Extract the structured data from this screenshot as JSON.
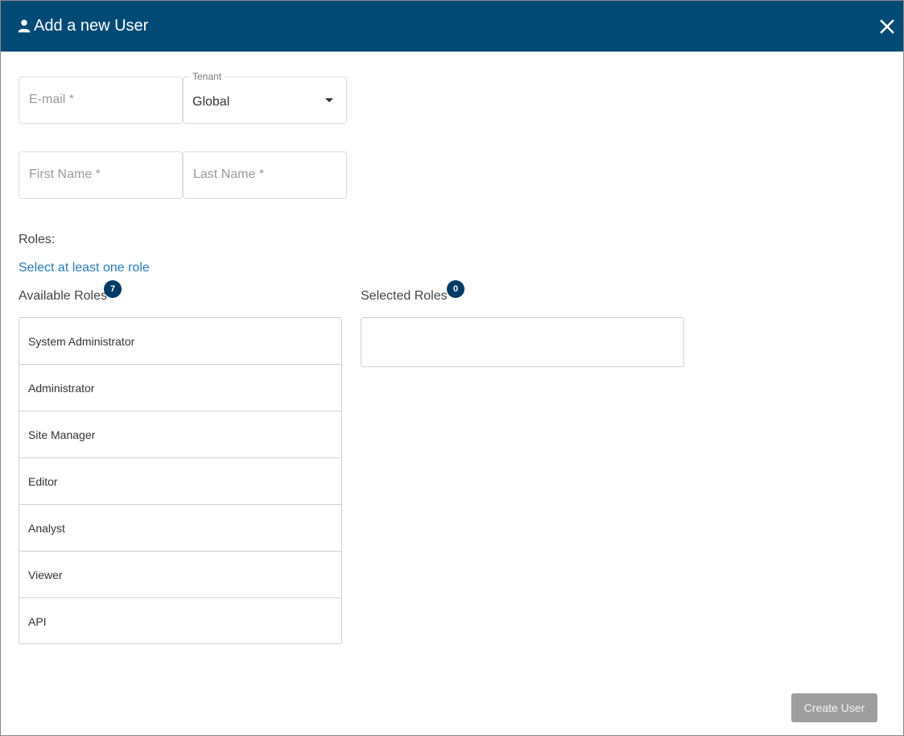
{
  "dialog": {
    "title": "Add a new User",
    "header_color": "#004a75",
    "title_icon": "user-icon",
    "close_icon": "close-icon"
  },
  "form": {
    "email": {
      "placeholder": "E-mail *",
      "value": ""
    },
    "tenant": {
      "label": "Tenant",
      "value": "Global"
    },
    "first_name": {
      "placeholder": "First Name *",
      "value": ""
    },
    "last_name": {
      "placeholder": "Last Name *",
      "value": ""
    }
  },
  "roles": {
    "label": "Roles:",
    "hint": "Select at least one role",
    "hint_color": "#2a7ab9",
    "available": {
      "title": "Available Roles",
      "count": "7",
      "items": [
        "System Administrator",
        "Administrator",
        "Site Manager",
        "Editor",
        "Analyst",
        "Viewer",
        "API"
      ]
    },
    "selected": {
      "title": "Selected Roles",
      "count": "0",
      "items": []
    }
  },
  "actions": {
    "create_label": "Create User"
  }
}
